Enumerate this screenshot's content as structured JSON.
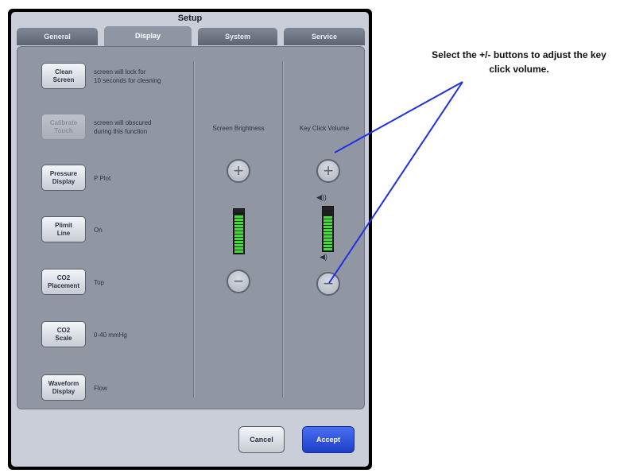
{
  "window": {
    "title": "Setup"
  },
  "tabs": [
    {
      "label": "General",
      "active": false
    },
    {
      "label": "Display",
      "active": true
    },
    {
      "label": "System",
      "active": false
    },
    {
      "label": "Service",
      "active": false
    }
  ],
  "settings": [
    {
      "button": "Clean\nScreen",
      "desc": "screen will lock for\n10 seconds for cleaning",
      "enabled": true
    },
    {
      "button": "Calibrate\nTouch",
      "desc": "screen will obscured\nduring this function",
      "enabled": false
    },
    {
      "button": "Pressure\nDisplay",
      "desc": "P Plot",
      "enabled": true
    },
    {
      "button": "Plimit\nLine",
      "desc": "On",
      "enabled": true
    },
    {
      "button": "CO2\nPlacement",
      "desc": "Top",
      "enabled": true
    },
    {
      "button": "CO2\nScale",
      "desc": "0-40 mmHg",
      "enabled": true
    },
    {
      "button": "Waveform\nDisplay",
      "desc": "Flow",
      "enabled": true
    }
  ],
  "controls": {
    "brightness": {
      "title": "Screen Brightness",
      "plus": "+",
      "minus": "−",
      "level": 0.9
    },
    "volume": {
      "title": "Key Click Volume",
      "plus": "+",
      "minus": "−",
      "level": 0.85,
      "speaker_high_icon": "speaker-high-icon",
      "speaker_low_icon": "speaker-low-icon"
    }
  },
  "footer": {
    "cancel": "Cancel",
    "accept": "Accept"
  },
  "annotation": {
    "text": "Select the +/- buttons to adjust the key click volume."
  },
  "colors": {
    "accept": "#2a4fe0",
    "bar_fill": "#3cdf34",
    "annotation_line": "#1f2fe6"
  }
}
